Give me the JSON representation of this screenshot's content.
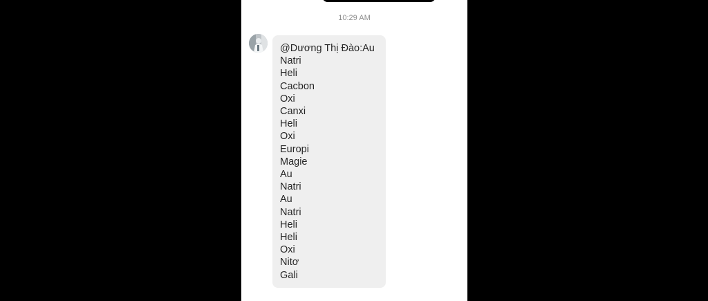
{
  "chat": {
    "timestamp": "10:29 AM",
    "message": {
      "mention": "@Dương Thị Đào:Au",
      "lines": [
        "Natri",
        "Heli",
        "Cacbon",
        "Oxi",
        "Canxi",
        "Heli",
        "Oxi",
        "Europi",
        "Magie",
        "Au",
        "Natri",
        "Au",
        "Natri",
        "Heli",
        "Heli",
        "Oxi",
        "Nitơ",
        "Gali"
      ]
    },
    "sender_avatar_icon": "user-avatar-icon"
  },
  "colors": {
    "background": "#000000",
    "chat_background": "#ffffff",
    "bubble_background": "#efefef",
    "message_text": "#262626",
    "timestamp_text": "#8e8e8e"
  }
}
